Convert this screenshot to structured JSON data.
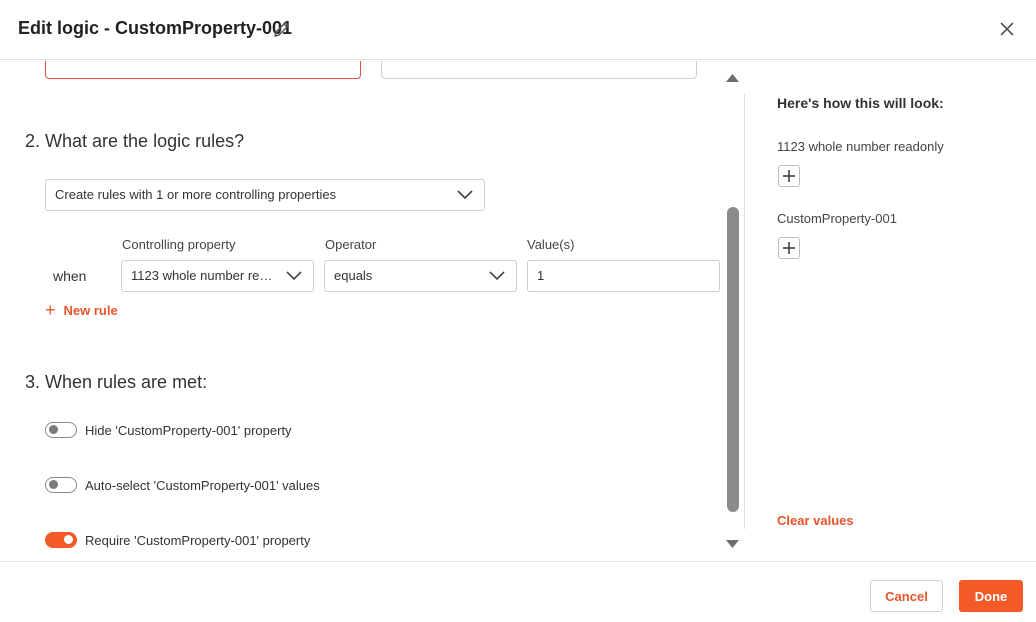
{
  "header": {
    "title": "Edit logic - CustomProperty-001",
    "edit_icon": "pencil-icon",
    "close_icon": "close-icon"
  },
  "section2": {
    "title": "2. What are the logic rules?",
    "mode_select": "Create rules with 1 or more controlling properties",
    "columns": {
      "controlling": "Controlling property",
      "operator": "Operator",
      "values": "Value(s)"
    },
    "rule": {
      "when": "when",
      "controlling_value": "1123 whole number readonly",
      "operator_value": "equals",
      "value": "1"
    },
    "new_rule": "New rule"
  },
  "section3": {
    "title": "3. When rules are met:",
    "toggles": [
      {
        "label": "Hide 'CustomProperty-001' property",
        "on": false
      },
      {
        "label": "Auto-select 'CustomProperty-001' values",
        "on": false
      },
      {
        "label": "Require 'CustomProperty-001' property",
        "on": true
      }
    ]
  },
  "preview": {
    "title": "Here's how this will look:",
    "items": [
      "1123 whole number readonly",
      "CustomProperty-001"
    ],
    "clear_values": "Clear values"
  },
  "footer": {
    "cancel": "Cancel",
    "done": "Done"
  },
  "colors": {
    "accent": "#f25a28",
    "link": "#e8552b",
    "error_border": "#e0553a"
  }
}
